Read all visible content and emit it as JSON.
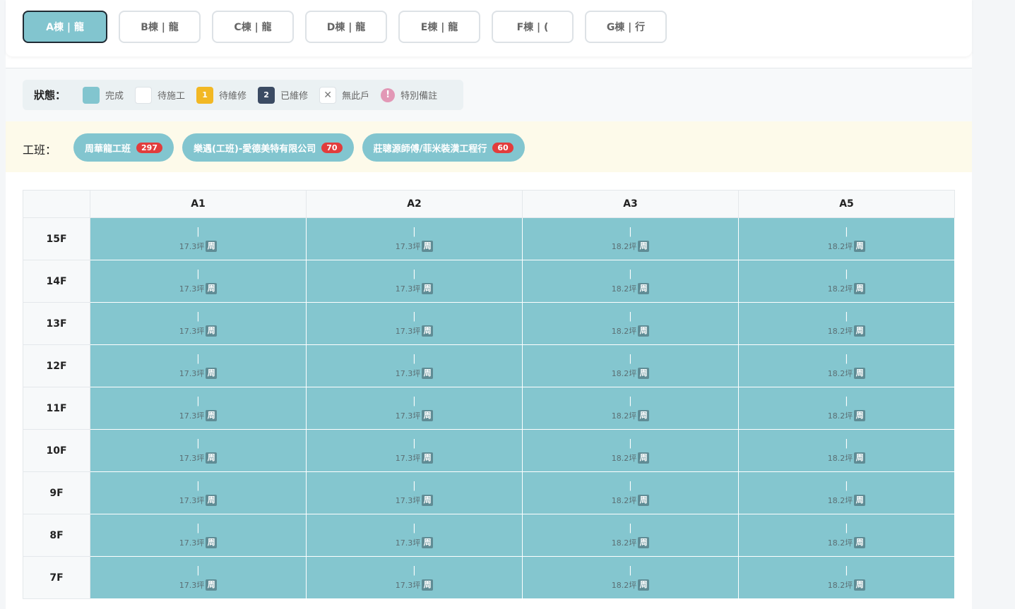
{
  "tabs": [
    "A棟 | 龍",
    "B棟 | 龍",
    "C棟 | 龍",
    "D棟 | 龍",
    "E棟 | 龍",
    "F棟 | (",
    "G棟 | 行"
  ],
  "legend": {
    "title": "狀態：",
    "items": [
      {
        "swatch": "",
        "label": "完成"
      },
      {
        "swatch": "",
        "label": "待施工"
      },
      {
        "swatch": "1",
        "label": "待維修"
      },
      {
        "swatch": "2",
        "label": "已維修"
      },
      {
        "swatch": "✕",
        "label": "無此戶"
      },
      {
        "swatch": "!",
        "label": "特別備註"
      }
    ]
  },
  "crews": {
    "title": "工班：",
    "items": [
      {
        "name": "周華龍工班",
        "count": "297"
      },
      {
        "name": "樂遇(工班)-愛德美特有限公司",
        "count": "70"
      },
      {
        "name": "莊聰源師傅/菲米裝潢工程行",
        "count": "60"
      }
    ]
  },
  "table": {
    "columns": [
      "A1",
      "A2",
      "A3",
      "A5"
    ],
    "rows": [
      {
        "floor": "15F",
        "cells": [
          {
            "top": "|",
            "area": "17.3坪",
            "tag": "周"
          },
          {
            "top": "|",
            "area": "17.3坪",
            "tag": "周"
          },
          {
            "top": "|",
            "area": "18.2坪",
            "tag": "周"
          },
          {
            "top": "|",
            "area": "18.2坪",
            "tag": "周"
          }
        ]
      },
      {
        "floor": "14F",
        "cells": [
          {
            "top": "|",
            "area": "17.3坪",
            "tag": "周"
          },
          {
            "top": "|",
            "area": "17.3坪",
            "tag": "周"
          },
          {
            "top": "|",
            "area": "18.2坪",
            "tag": "周"
          },
          {
            "top": "|",
            "area": "18.2坪",
            "tag": "周"
          }
        ]
      },
      {
        "floor": "13F",
        "cells": [
          {
            "top": "|",
            "area": "17.3坪",
            "tag": "周"
          },
          {
            "top": "|",
            "area": "17.3坪",
            "tag": "周"
          },
          {
            "top": "|",
            "area": "18.2坪",
            "tag": "周"
          },
          {
            "top": "|",
            "area": "18.2坪",
            "tag": "周"
          }
        ]
      },
      {
        "floor": "12F",
        "cells": [
          {
            "top": "|",
            "area": "17.3坪",
            "tag": "周"
          },
          {
            "top": "|",
            "area": "17.3坪",
            "tag": "周"
          },
          {
            "top": "|",
            "area": "18.2坪",
            "tag": "周"
          },
          {
            "top": "|",
            "area": "18.2坪",
            "tag": "周"
          }
        ]
      },
      {
        "floor": "11F",
        "cells": [
          {
            "top": "|",
            "area": "17.3坪",
            "tag": "周"
          },
          {
            "top": "|",
            "area": "17.3坪",
            "tag": "周"
          },
          {
            "top": "|",
            "area": "18.2坪",
            "tag": "周"
          },
          {
            "top": "|",
            "area": "18.2坪",
            "tag": "周"
          }
        ]
      },
      {
        "floor": "10F",
        "cells": [
          {
            "top": "|",
            "area": "17.3坪",
            "tag": "周"
          },
          {
            "top": "|",
            "area": "17.3坪",
            "tag": "周"
          },
          {
            "top": "|",
            "area": "18.2坪",
            "tag": "周"
          },
          {
            "top": "|",
            "area": "18.2坪",
            "tag": "周"
          }
        ]
      },
      {
        "floor": "9F",
        "cells": [
          {
            "top": "|",
            "area": "17.3坪",
            "tag": "周"
          },
          {
            "top": "|",
            "area": "17.3坪",
            "tag": "周"
          },
          {
            "top": "|",
            "area": "18.2坪",
            "tag": "周"
          },
          {
            "top": "|",
            "area": "18.2坪",
            "tag": "周"
          }
        ]
      },
      {
        "floor": "8F",
        "cells": [
          {
            "top": "|",
            "area": "17.3坪",
            "tag": "周"
          },
          {
            "top": "|",
            "area": "17.3坪",
            "tag": "周"
          },
          {
            "top": "|",
            "area": "18.2坪",
            "tag": "周"
          },
          {
            "top": "|",
            "area": "18.2坪",
            "tag": "周"
          }
        ]
      },
      {
        "floor": "7F",
        "cells": [
          {
            "top": "|",
            "area": "17.3坪",
            "tag": "周"
          },
          {
            "top": "|",
            "area": "17.3坪",
            "tag": "周"
          },
          {
            "top": "|",
            "area": "18.2坪",
            "tag": "周"
          },
          {
            "top": "|",
            "area": "18.2坪",
            "tag": "周"
          }
        ]
      }
    ]
  },
  "colors": {
    "accent": "#82c5cf",
    "cell_done": "#84c6cf",
    "repair": "#f2b824",
    "repaired": "#3b4b63",
    "note": "#e298b6",
    "badge": "#e23c3c",
    "crew_band": "#fdfaea"
  }
}
